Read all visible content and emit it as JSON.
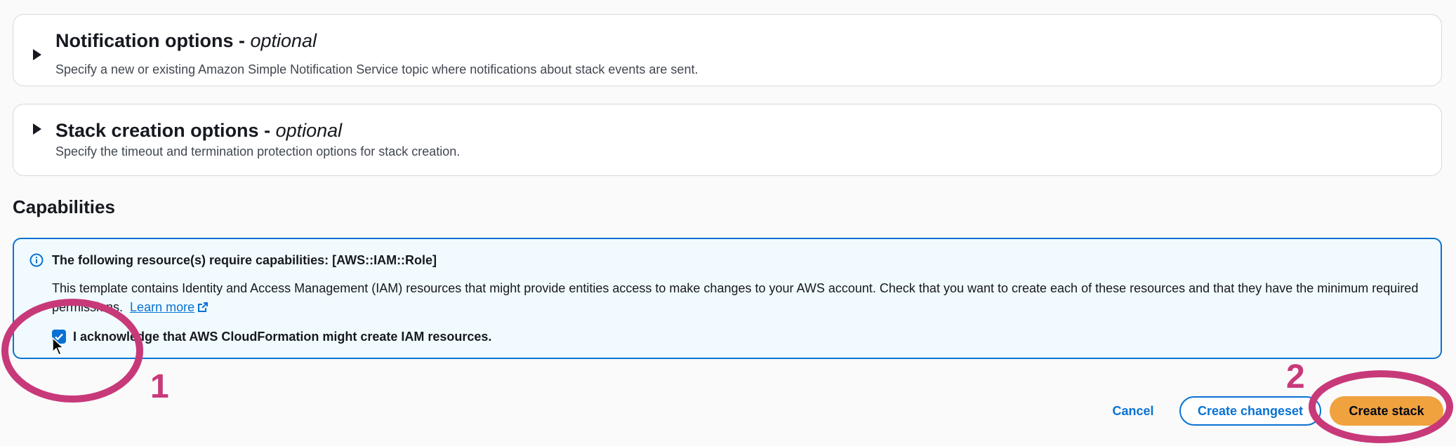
{
  "notification": {
    "title": "Notification options - ",
    "title_suffix": "optional",
    "description": "Specify a new or existing Amazon Simple Notification Service topic where notifications about stack events are sent."
  },
  "stack_creation": {
    "title": "Stack creation options - ",
    "title_suffix": "optional",
    "description": "Specify the timeout and termination protection options for stack creation."
  },
  "capabilities": {
    "heading": "Capabilities",
    "alert_title": "The following resource(s) require capabilities: [AWS::IAM::Role]",
    "alert_body": "This template contains Identity and Access Management (IAM) resources that might provide entities access to make changes to your AWS account. Check that you want to create each of these resources and that they have the minimum required permissions.",
    "learn_more": "Learn more",
    "acknowledge_label": "I acknowledge that AWS CloudFormation might create IAM resources.",
    "acknowledge_checked": true
  },
  "actions": {
    "cancel": "Cancel",
    "create_changeset": "Create changeset",
    "create_stack": "Create stack"
  },
  "annotations": {
    "step1": "1",
    "step2": "2",
    "color": "#c8397a"
  },
  "colors": {
    "accent": "#0972d3",
    "primary_button": "#f0a23f",
    "alert_bg": "#f1faff"
  }
}
